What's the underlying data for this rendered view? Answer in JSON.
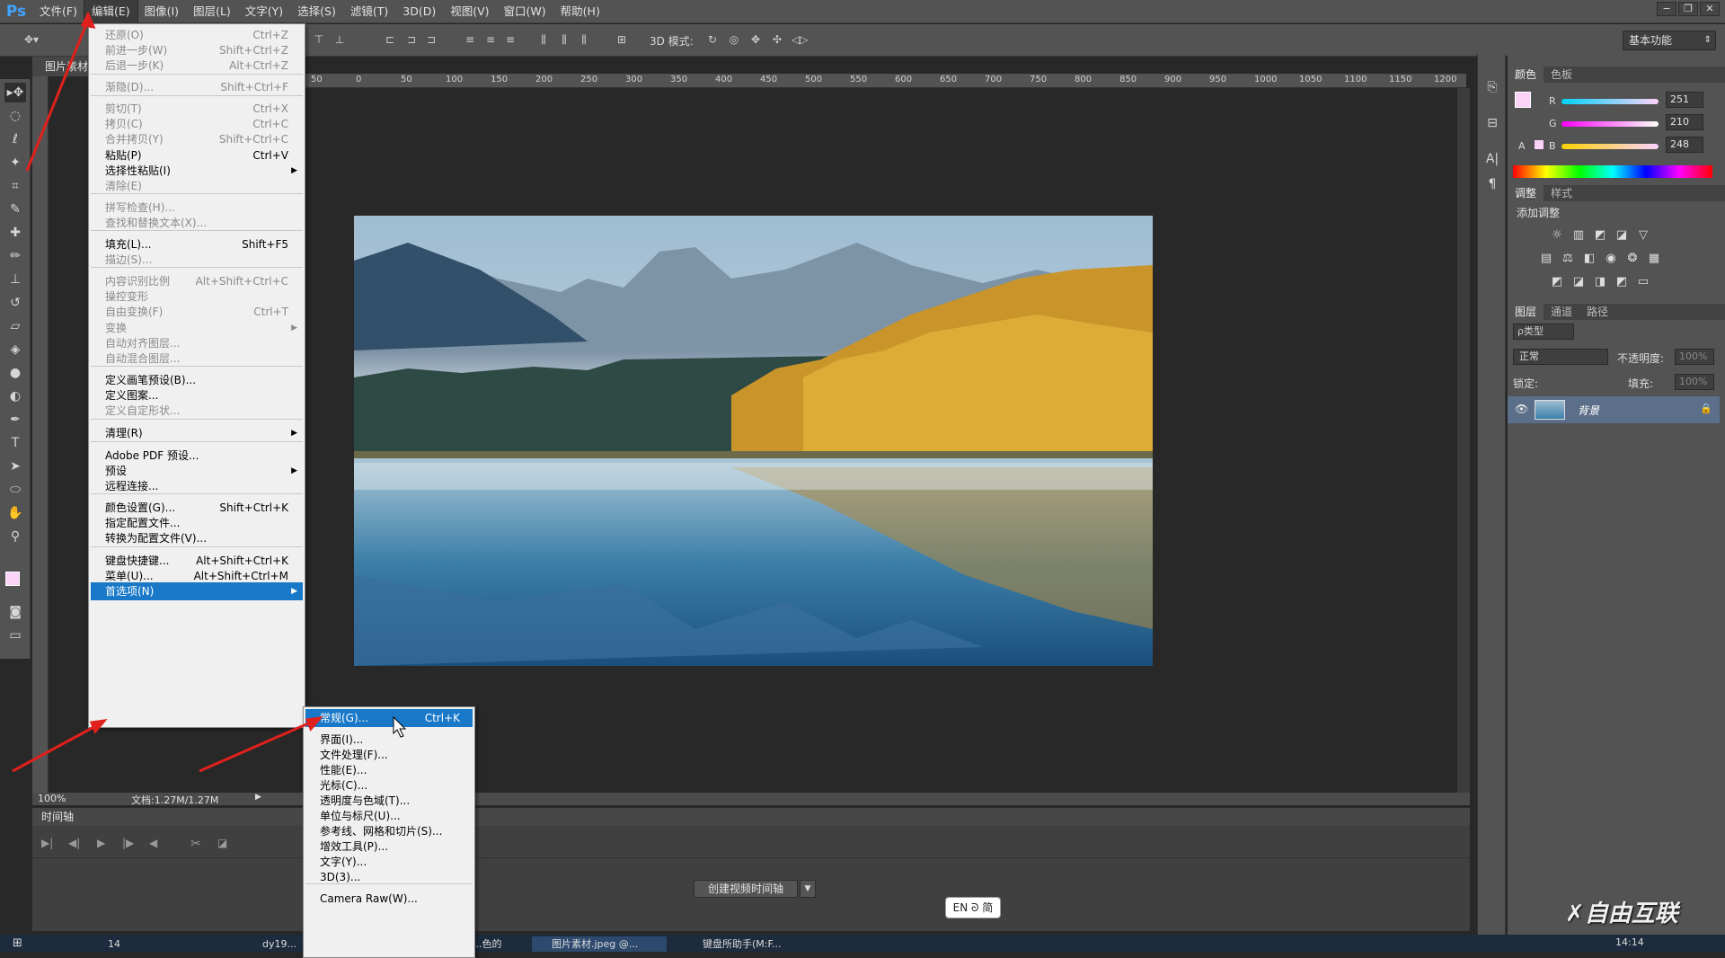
{
  "app": {
    "logo": "Ps"
  },
  "menubar": [
    "文件(F)",
    "编辑(E)",
    "图像(I)",
    "图层(L)",
    "文字(Y)",
    "选择(S)",
    "滤镜(T)",
    "3D(D)",
    "视图(V)",
    "窗口(W)",
    "帮助(H)"
  ],
  "window_controls": [
    "−",
    "❐",
    "✕"
  ],
  "optionsbar": {
    "mode3d_label": "3D 模式:",
    "workspace": "基本功能"
  },
  "document": {
    "tab_label": "图片素材",
    "zoom": "100%",
    "doc_size": "文档:1.27M/1.27M"
  },
  "ruler": {
    "h_labels": [
      "50",
      "0",
      "50",
      "100",
      "150",
      "200",
      "250",
      "300",
      "350",
      "400",
      "450",
      "500",
      "550",
      "600",
      "650",
      "700",
      "750",
      "800",
      "850",
      "900",
      "950",
      "1000",
      "1050",
      "1100",
      "1150",
      "1200"
    ]
  },
  "edit_menu": [
    {
      "label": "还原(O)",
      "key": "Ctrl+Z",
      "disabled": true
    },
    {
      "label": "前进一步(W)",
      "key": "Shift+Ctrl+Z",
      "disabled": true
    },
    {
      "label": "后退一步(K)",
      "key": "Alt+Ctrl+Z",
      "disabled": true
    },
    {
      "label": "渐隐(D)...",
      "key": "Shift+Ctrl+F",
      "disabled": true
    },
    {
      "label": "剪切(T)",
      "key": "Ctrl+X",
      "disabled": true
    },
    {
      "label": "拷贝(C)",
      "key": "Ctrl+C",
      "disabled": true
    },
    {
      "label": "合并拷贝(Y)",
      "key": "Shift+Ctrl+C",
      "disabled": true
    },
    {
      "label": "粘贴(P)",
      "key": "Ctrl+V",
      "disabled": false
    },
    {
      "label": "选择性粘贴(I)",
      "key": "",
      "disabled": false,
      "sub": true
    },
    {
      "label": "清除(E)",
      "key": "",
      "disabled": true
    },
    {
      "label": "拼写检查(H)...",
      "key": "",
      "disabled": true
    },
    {
      "label": "查找和替换文本(X)...",
      "key": "",
      "disabled": true
    },
    {
      "label": "填充(L)...",
      "key": "Shift+F5",
      "disabled": false
    },
    {
      "label": "描边(S)...",
      "key": "",
      "disabled": true
    },
    {
      "label": "内容识别比例",
      "key": "Alt+Shift+Ctrl+C",
      "disabled": true
    },
    {
      "label": "操控变形",
      "key": "",
      "disabled": true
    },
    {
      "label": "自由变换(F)",
      "key": "Ctrl+T",
      "disabled": true
    },
    {
      "label": "变换",
      "key": "",
      "disabled": true,
      "sub": true
    },
    {
      "label": "自动对齐图层...",
      "key": "",
      "disabled": true
    },
    {
      "label": "自动混合图层...",
      "key": "",
      "disabled": true
    },
    {
      "label": "定义画笔预设(B)...",
      "key": "",
      "disabled": false
    },
    {
      "label": "定义图案...",
      "key": "",
      "disabled": false
    },
    {
      "label": "定义自定形状...",
      "key": "",
      "disabled": true
    },
    {
      "label": "清理(R)",
      "key": "",
      "disabled": false,
      "sub": true
    },
    {
      "label": "Adobe PDF 预设...",
      "key": "",
      "disabled": false
    },
    {
      "label": "预设",
      "key": "",
      "disabled": false,
      "sub": true
    },
    {
      "label": "远程连接...",
      "key": "",
      "disabled": false
    },
    {
      "label": "颜色设置(G)...",
      "key": "Shift+Ctrl+K",
      "disabled": false
    },
    {
      "label": "指定配置文件...",
      "key": "",
      "disabled": false
    },
    {
      "label": "转换为配置文件(V)...",
      "key": "",
      "disabled": false
    },
    {
      "label": "键盘快捷键...",
      "key": "Alt+Shift+Ctrl+K",
      "disabled": false
    },
    {
      "label": "菜单(U)...",
      "key": "Alt+Shift+Ctrl+M",
      "disabled": false
    },
    {
      "label": "首选项(N)",
      "key": "",
      "disabled": false,
      "sub": true,
      "highlight": true
    }
  ],
  "pref_submenu": [
    {
      "label": "常规(G)...",
      "key": "Ctrl+K",
      "highlight": true
    },
    {
      "label": "界面(I)...",
      "key": ""
    },
    {
      "label": "文件处理(F)...",
      "key": ""
    },
    {
      "label": "性能(E)...",
      "key": ""
    },
    {
      "label": "光标(C)...",
      "key": ""
    },
    {
      "label": "透明度与色域(T)...",
      "key": ""
    },
    {
      "label": "单位与标尺(U)...",
      "key": ""
    },
    {
      "label": "参考线、网格和切片(S)...",
      "key": ""
    },
    {
      "label": "增效工具(P)...",
      "key": ""
    },
    {
      "label": "文字(Y)...",
      "key": ""
    },
    {
      "label": "3D(3)...",
      "key": ""
    },
    {
      "label": "Camera Raw(W)...",
      "key": ""
    }
  ],
  "timeline": {
    "title": "时间轴",
    "create_button": "创建视频时间轴"
  },
  "ime": {
    "label": "EN ᘐ 简"
  },
  "panels": {
    "color_tabs": [
      "颜色",
      "色板"
    ],
    "rgb": [
      {
        "ch": "R",
        "val": "251"
      },
      {
        "ch": "G",
        "val": "210"
      },
      {
        "ch": "B",
        "val": "248"
      }
    ],
    "adjust_tabs": [
      "调整",
      "样式"
    ],
    "adjust_title": "添加调整",
    "layers_tabs": [
      "图层",
      "通道",
      "路径"
    ],
    "layers_filter": "ρ类型",
    "blend_mode": "正常",
    "opacity_label": "不透明度:",
    "opacity_val": "100%",
    "lock_label": "锁定:",
    "fill_label": "填充:",
    "fill_val": "100%",
    "layer_name": "背景"
  },
  "taskbar": {
    "items": [
      "14",
      "dy19...",
      "...色的",
      "图片素材.jpeg @...",
      "键盘所助手(M:F..."
    ],
    "time": "14:14"
  },
  "watermark": "✗自由互联",
  "colors": {
    "fg_swatch": "#fbd2f8",
    "highlight": "#1979c8",
    "arrow": "#e0201c"
  }
}
